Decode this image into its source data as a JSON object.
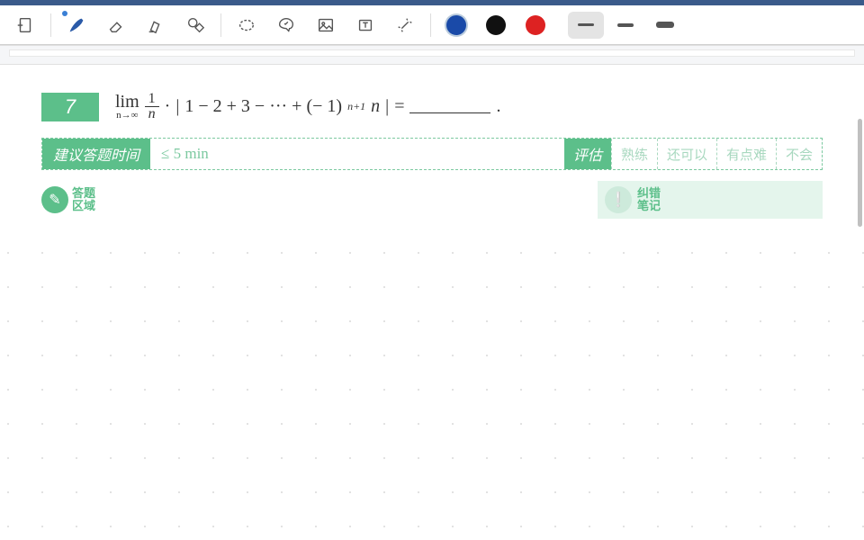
{
  "toolbar": {
    "icons": [
      "insert-page",
      "pen",
      "eraser",
      "highlighter",
      "shapes",
      "lasso",
      "sticker",
      "image",
      "text",
      "laser"
    ],
    "colors": {
      "blue": "#1a4aa8",
      "black": "#111",
      "red": "#d22"
    },
    "selected_color": "blue",
    "thickness_selected": 0
  },
  "question": {
    "number": "7",
    "math_tokens": {
      "lim": "lim",
      "lim_sub": "n→∞",
      "frac_num": "1",
      "frac_den": "n",
      "dot": "·",
      "abs_l": "|",
      "expr": "1 − 2 + 3 − ··· + (− 1)",
      "sup": "n+1",
      "tail": "n",
      "abs_r": "|",
      "eq": "=",
      "period": "."
    }
  },
  "meta": {
    "time_label": "建议答题时间",
    "time_value": "≤ 5 min",
    "eval_label": "评估",
    "options": [
      "熟练",
      "还可以",
      "有点难",
      "不会"
    ]
  },
  "zones": {
    "answer": {
      "l1": "答题",
      "l2": "区域"
    },
    "notes": {
      "l1": "纠错",
      "l2": "笔记"
    }
  }
}
